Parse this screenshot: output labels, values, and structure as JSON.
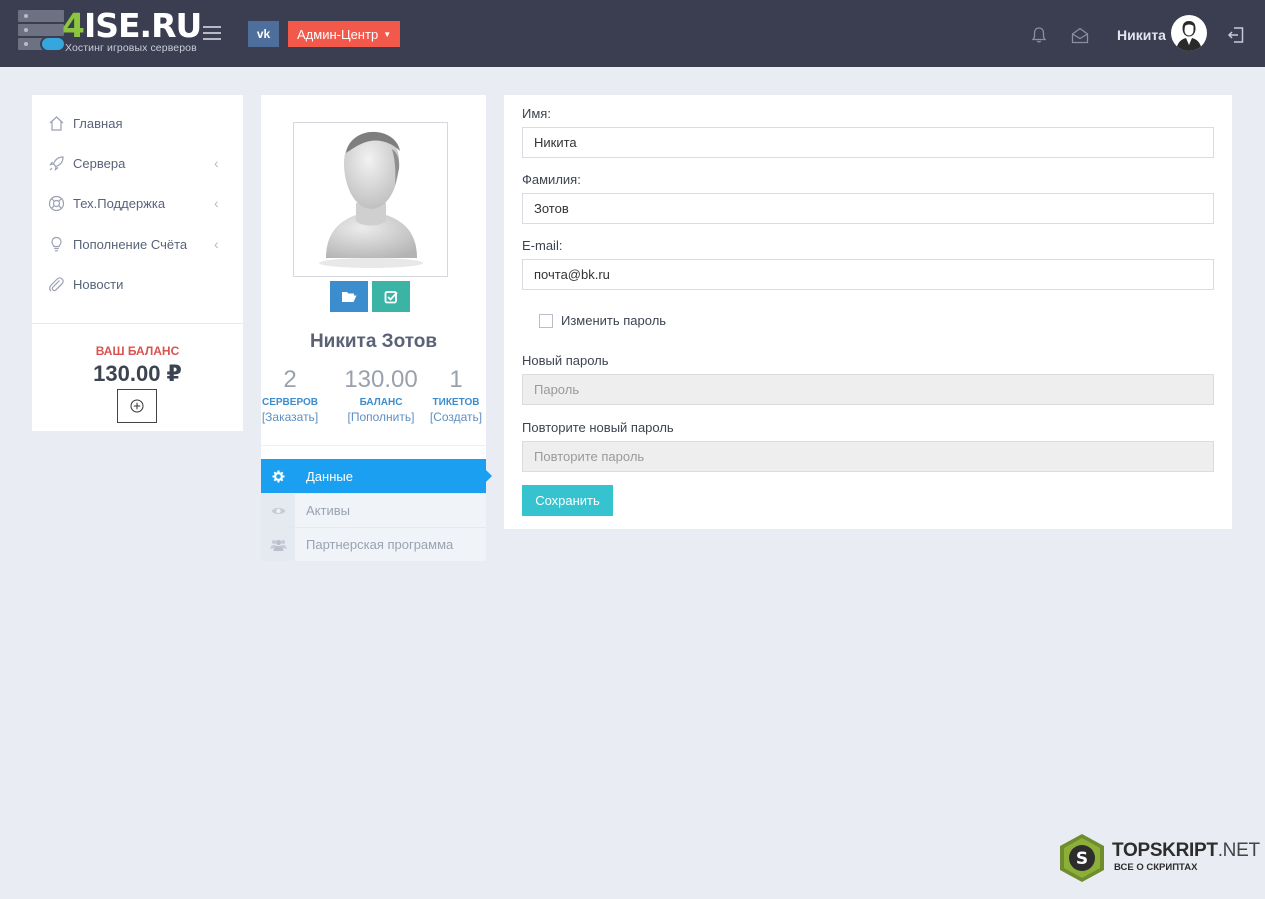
{
  "header": {
    "logo_brand_number": "4",
    "logo_brand_rest": "ISE.RU",
    "logo_tagline": "Хостинг игровых серверов",
    "vk_label": "vk",
    "admin_center_label": "Админ-Центр",
    "user_name": "Никита",
    "background": "#3b3d50"
  },
  "sidebar": {
    "items": [
      {
        "label": "Главная",
        "icon": "home-icon",
        "has_submenu": false
      },
      {
        "label": "Сервера",
        "icon": "rocket-icon",
        "has_submenu": true
      },
      {
        "label": "Тех.Поддержка",
        "icon": "lifebuoy-icon",
        "has_submenu": true
      },
      {
        "label": "Пополнение Счёта",
        "icon": "lightbulb-icon",
        "has_submenu": true
      },
      {
        "label": "Новости",
        "icon": "paperclip-icon",
        "has_submenu": false
      }
    ],
    "balance_title": "ВАШ БАЛАНС",
    "balance_value": "130.00 ₽",
    "add_icon": "plus-circle-icon"
  },
  "profile": {
    "full_name": "Никита Зотов",
    "stats": [
      {
        "value": "2",
        "caption": "СЕРВЕРОВ",
        "link": "[Заказать]"
      },
      {
        "value": "130.00",
        "caption": "БАЛАНС",
        "link": "[Пополнить]"
      },
      {
        "value": "1",
        "caption": "ТИКЕТОВ",
        "link": "[Создать]"
      }
    ],
    "tabs": [
      {
        "label": "Данные",
        "icon": "gear-icon",
        "active": true
      },
      {
        "label": "Активы",
        "icon": "eye-icon",
        "active": false
      },
      {
        "label": "Партнерская программа",
        "icon": "users-icon",
        "active": false
      }
    ]
  },
  "form": {
    "first_name_label": "Имя:",
    "first_name_value": "Никита",
    "last_name_label": "Фамилия:",
    "last_name_value": "Зотов",
    "email_label": "E-mail:",
    "email_value": "почта@bk.ru",
    "change_password_label": "Изменить пароль",
    "new_password_label": "Новый пароль",
    "new_password_placeholder": "Пароль",
    "repeat_password_label": "Повторите новый пароль",
    "repeat_password_placeholder": "Повторите пароль",
    "save_label": "Сохранить"
  },
  "watermark": {
    "title_main": "TOPSKRIPT",
    "title_suffix": ".NET",
    "subtitle": "ВСЕ О СКРИПТАХ",
    "badge_letter": "S"
  },
  "colors": {
    "accent_blue": "#1b9ff0",
    "danger": "#f2594b",
    "save": "#36c3d0",
    "balance_title": "#d9534f"
  }
}
